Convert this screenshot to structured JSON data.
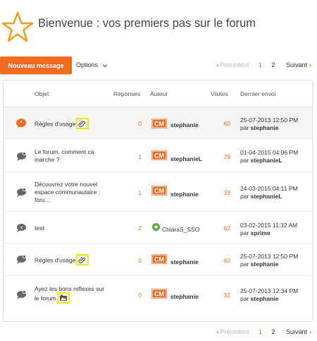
{
  "header": {
    "title": "Bienvenue : vos premiers pas sur le forum"
  },
  "toolbar": {
    "new_message": "Nouveau message",
    "options": "Options"
  },
  "pagination": {
    "previous": "Précédent",
    "pages": [
      "1",
      "2"
    ],
    "current_page": "1",
    "next": "Suivant"
  },
  "columns": {
    "subject": "Objet",
    "replies": "Réponses",
    "author": "Auteur",
    "visits": "Visites",
    "last_post": "Dernier envoi"
  },
  "topics": [
    {
      "subject": "Règles d'usage",
      "replies": "0",
      "author": "stephanie",
      "visits": "60",
      "last_date": "25-07-2013 12:50 PM",
      "by_prefix": "par",
      "last_by": "stephanie"
    },
    {
      "subject": "Le forum, comment ca marche ?",
      "replies": "1",
      "author": "stephanieL",
      "visits": "29",
      "last_date": "01-04-2015 04:06 PM",
      "by_prefix": "par",
      "last_by": "stephanieL"
    },
    {
      "subject": "Découvrez votre nouvel espace communautaire : foru...",
      "replies": "1",
      "author": "stephanie",
      "visits": "33",
      "last_date": "24-03-2015 04:11 PM",
      "by_prefix": "par",
      "last_by": "stephanieL"
    },
    {
      "subject": "test",
      "replies": "2",
      "author": "ChiaraS_SSO",
      "visits": "62",
      "last_date": "03-02-2015 11:32 AM",
      "by_prefix": "par",
      "last_by": "xprime"
    },
    {
      "subject": "Règles d'usage",
      "replies": "0",
      "author": "stephanie",
      "visits": "60",
      "last_date": "25-07-2013 12:50 PM",
      "by_prefix": "par",
      "last_by": "stephanie"
    },
    {
      "subject": "Ayez les bons reflexes sur le forum",
      "replies": "0",
      "author": "stephanie",
      "visits": "32",
      "last_date": "25-07-2013 12:34 PM",
      "by_prefix": "par",
      "last_by": "stephanie"
    }
  ],
  "avatar_badge": "CM",
  "colors": {
    "accent": "#f26b21",
    "highlight_box": "#f6e600",
    "row_highlight": "#f5f5f5"
  }
}
